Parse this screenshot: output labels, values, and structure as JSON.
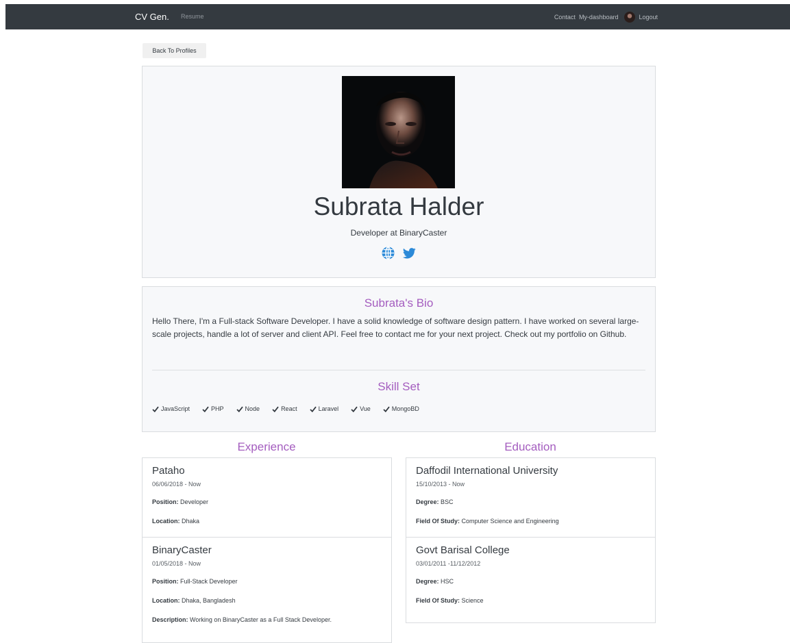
{
  "navbar": {
    "brand": "CV Gen.",
    "resume": "Resume",
    "contact": "Contact",
    "dashboard": "My-dashboard",
    "logout": "Logout"
  },
  "back_button": "Back To Profiles",
  "profile": {
    "name": "Subrata Halder",
    "headline": "Developer at BinaryCaster",
    "social_icons": [
      "globe-icon",
      "twitter-icon"
    ]
  },
  "bio": {
    "title": "Subrata's Bio",
    "text": "Hello There, I'm a Full-stack Software Developer. I have a solid knowledge of software design pattern. I have worked on several large-scale projects, handle a lot of server and client API. Feel free to contact me for your next project. Check out my portfolio on Github."
  },
  "skills": {
    "title": "Skill Set",
    "items": [
      "JavaScript",
      "PHP",
      "Node",
      "React",
      "Laravel",
      "Vue",
      "MongoBD"
    ]
  },
  "experience": {
    "title": "Experience",
    "items": [
      {
        "company": "Pataho",
        "dates": "06/06/2018 - Now",
        "position_label": "Position:",
        "position": "Developer",
        "location_label": "Location:",
        "location": "Dhaka"
      },
      {
        "company": "BinaryCaster",
        "dates": "01/05/2018 - Now",
        "position_label": "Position:",
        "position": "Full-Stack Developer",
        "location_label": "Location:",
        "location": "Dhaka, Bangladesh",
        "description_label": "Description:",
        "description": "Working on BinaryCaster as a Full Stack Developer."
      }
    ]
  },
  "education": {
    "title": "Education",
    "items": [
      {
        "school": "Daffodil International University",
        "dates": "15/10/2013 - Now",
        "degree_label": "Degree:",
        "degree": "BSC",
        "field_label": "Field Of Study:",
        "field": "Computer Science and Engineering"
      },
      {
        "school": "Govt Barisal College",
        "dates": "03/01/2011 -11/12/2012",
        "degree_label": "Degree:",
        "degree": "HSC",
        "field_label": "Field Of Study:",
        "field": "Science"
      }
    ]
  },
  "colors": {
    "navbar": "#343a40",
    "accent_purple": "#a45dbf",
    "icon_blue": "#2c8ad8",
    "card_bg": "#f7f8fa"
  }
}
